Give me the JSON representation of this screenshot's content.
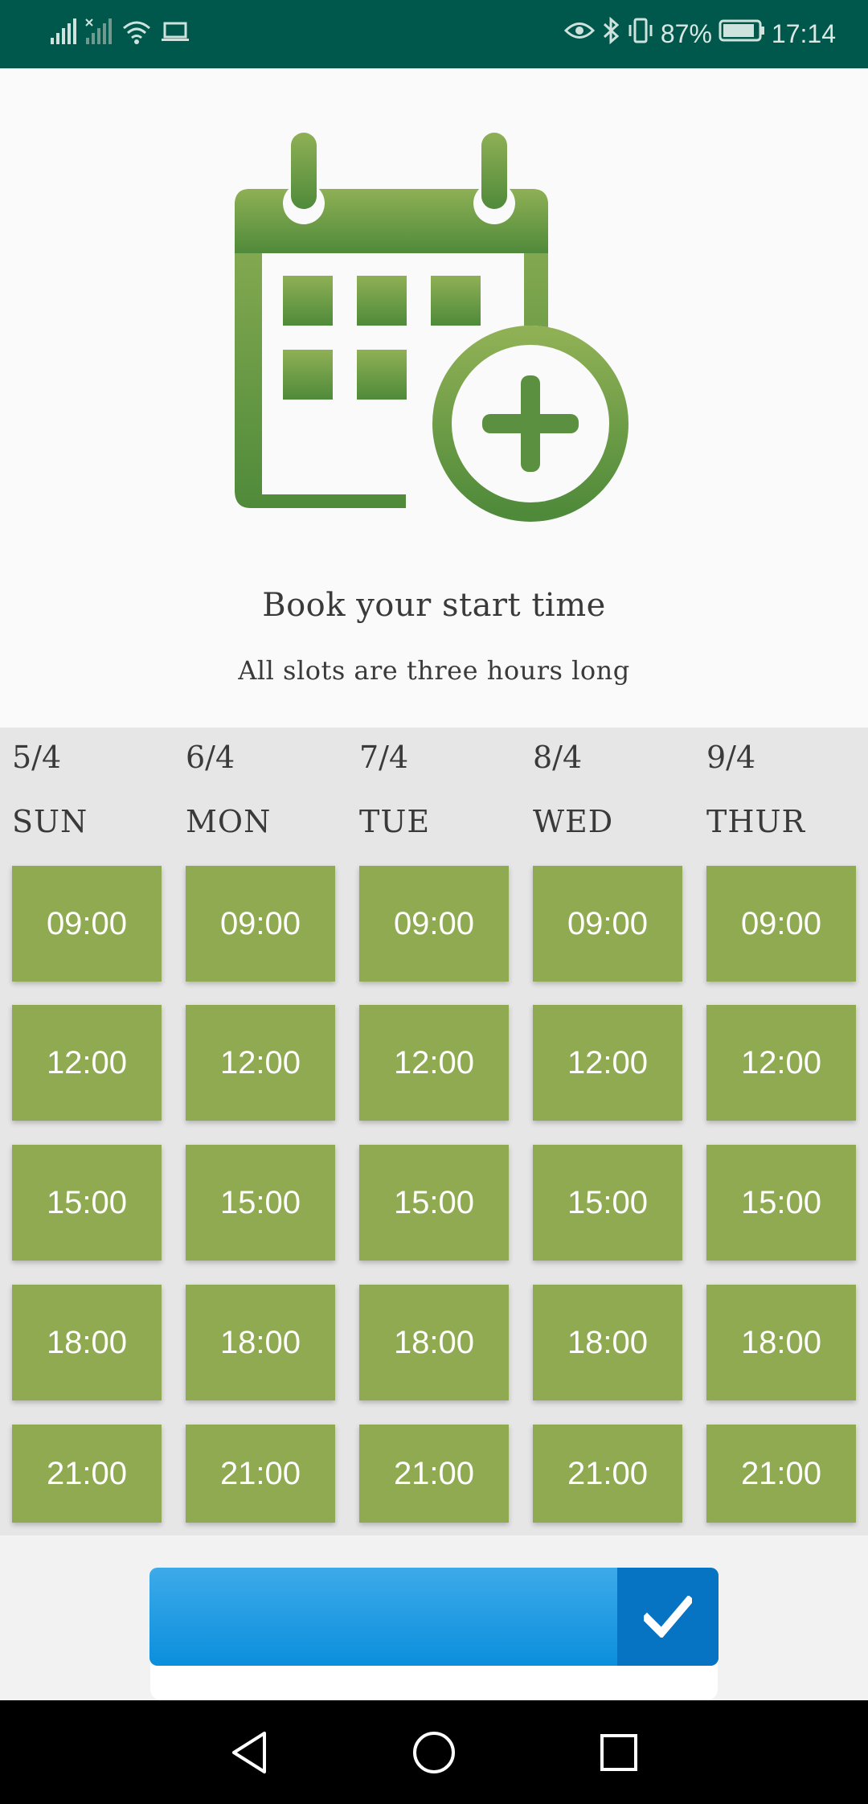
{
  "status_bar": {
    "battery": "87%",
    "time": "17:14",
    "icons": [
      "signal-icon",
      "signal-no-sim-icon",
      "wifi-icon",
      "laptop-icon",
      "eye-icon",
      "bluetooth-icon",
      "vibrate-icon",
      "battery-icon"
    ]
  },
  "header": {
    "icon": "calendar-add-icon",
    "title": "Book your start time",
    "subtitle": "All slots are three hours long"
  },
  "days": [
    {
      "date": "5/4",
      "day": "SUN",
      "slots": [
        "09:00",
        "12:00",
        "15:00",
        "18:00",
        "21:00"
      ]
    },
    {
      "date": "6/4",
      "day": "MON",
      "slots": [
        "09:00",
        "12:00",
        "15:00",
        "18:00",
        "21:00"
      ]
    },
    {
      "date": "7/4",
      "day": "TUE",
      "slots": [
        "09:00",
        "12:00",
        "15:00",
        "18:00",
        "21:00"
      ]
    },
    {
      "date": "8/4",
      "day": "WED",
      "slots": [
        "09:00",
        "12:00",
        "15:00",
        "18:00",
        "21:00"
      ]
    },
    {
      "date": "9/4",
      "day": "THUR",
      "slots": [
        "09:00",
        "12:00",
        "15:00",
        "18:00",
        "21:00"
      ]
    }
  ],
  "confirm": {
    "icon": "check-icon"
  },
  "nav": {
    "icons": [
      "back-icon",
      "home-icon",
      "recents-icon"
    ]
  },
  "colors": {
    "status_bar": "#00574b",
    "slot": "#8faa51",
    "icon_green": "#6b9a44",
    "confirm_blue": "#1e9be3",
    "confirm_dark": "#0774c3"
  }
}
